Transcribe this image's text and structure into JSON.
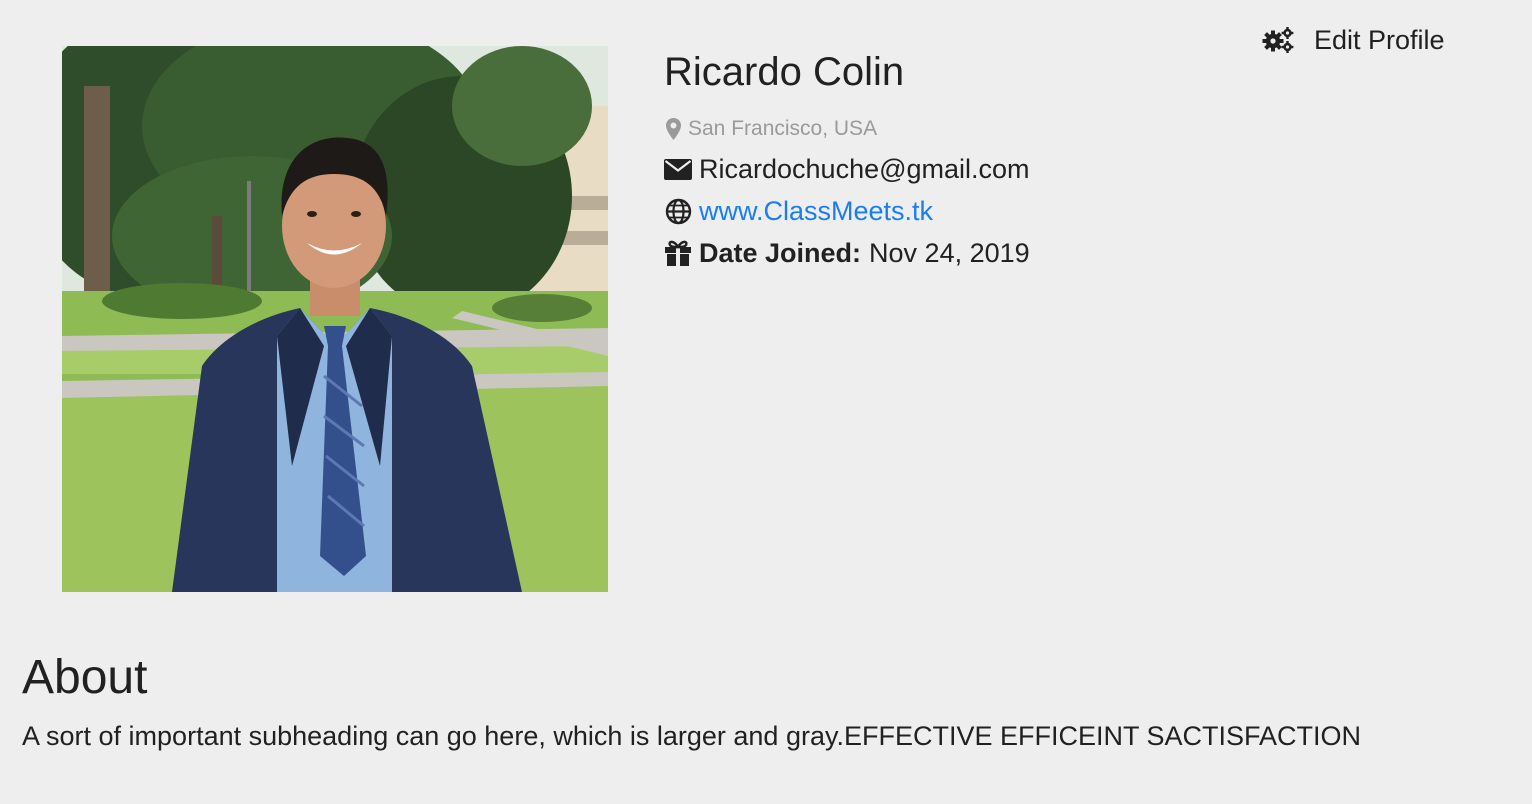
{
  "header": {
    "edit_profile_label": "Edit Profile",
    "edit_icon": "gears-icon"
  },
  "profile": {
    "photo_alt": "Ricardo Colin",
    "name": "Ricardo Colin",
    "location": "San Francisco, USA",
    "location_icon": "map-marker-icon",
    "email": "Ricardochuche@gmail.com",
    "email_icon": "envelope-icon",
    "website": "www.ClassMeets.tk",
    "website_icon": "globe-icon",
    "date_joined_label": "Date Joined:",
    "date_joined_value": "Nov 24, 2019",
    "date_joined_icon": "gift-icon"
  },
  "about": {
    "heading": "About",
    "text": "A sort of important subheading can go here, which is larger and gray.EFFECTIVE EFFICEINT SACTISFACTION"
  },
  "colors": {
    "background": "#eeeeee",
    "text": "#212121",
    "muted": "#9a9a9a",
    "link": "#1a7ef1"
  }
}
